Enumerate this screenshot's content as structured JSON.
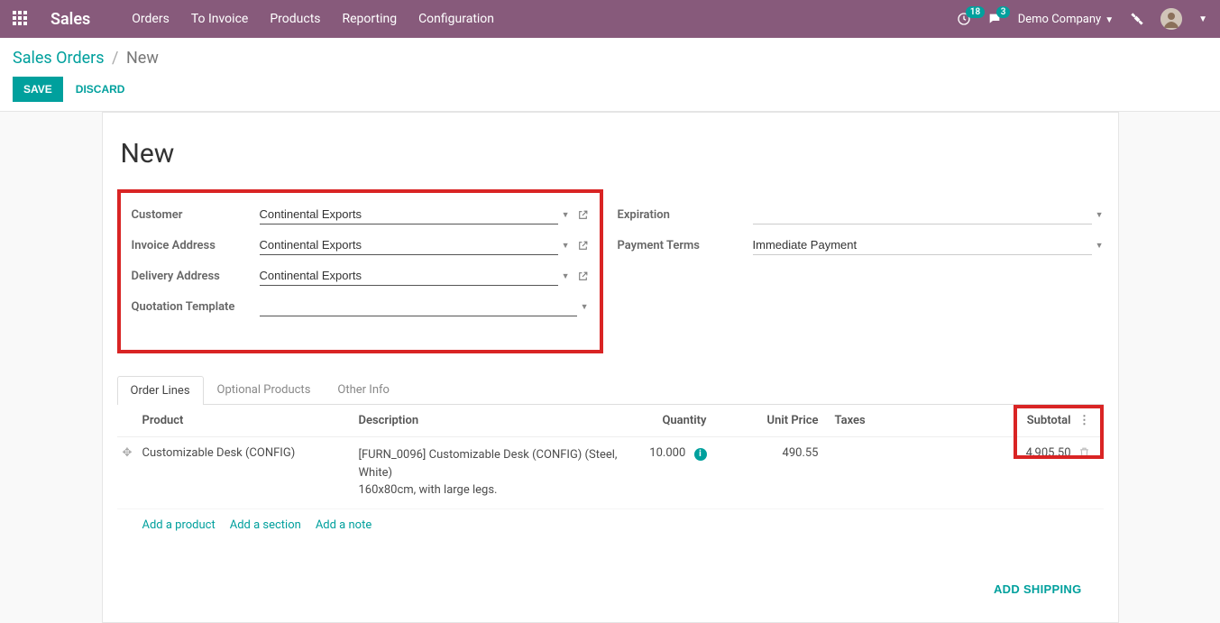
{
  "topbar": {
    "brand": "Sales",
    "menu": [
      "Orders",
      "To Invoice",
      "Products",
      "Reporting",
      "Configuration"
    ],
    "clock_badge": "18",
    "chat_badge": "3",
    "company": "Demo Company"
  },
  "breadcrumb": {
    "root": "Sales Orders",
    "current": "New"
  },
  "buttons": {
    "save": "SAVE",
    "discard": "DISCARD",
    "add_shipping": "ADD SHIPPING"
  },
  "title": "New",
  "fields": {
    "customer_label": "Customer",
    "customer": "Continental Exports",
    "invoice_label": "Invoice Address",
    "invoice": "Continental Exports",
    "delivery_label": "Delivery Address",
    "delivery": "Continental Exports",
    "template_label": "Quotation Template",
    "template": "",
    "expiration_label": "Expiration",
    "expiration": "",
    "terms_label": "Payment Terms",
    "terms": "Immediate Payment"
  },
  "tabs": {
    "order_lines": "Order Lines",
    "optional": "Optional Products",
    "other": "Other Info"
  },
  "grid": {
    "headers": {
      "product": "Product",
      "description": "Description",
      "quantity": "Quantity",
      "unit_price": "Unit Price",
      "taxes": "Taxes",
      "subtotal": "Subtotal"
    },
    "row": {
      "product": "Customizable Desk (CONFIG)",
      "description": "[FURN_0096] Customizable Desk (CONFIG) (Steel, White)\n160x80cm, with large legs.",
      "quantity": "10.000",
      "unit_price": "490.55",
      "subtotal": "4,905.50"
    },
    "add": {
      "product": "Add a product",
      "section": "Add a section",
      "note": "Add a note"
    }
  }
}
